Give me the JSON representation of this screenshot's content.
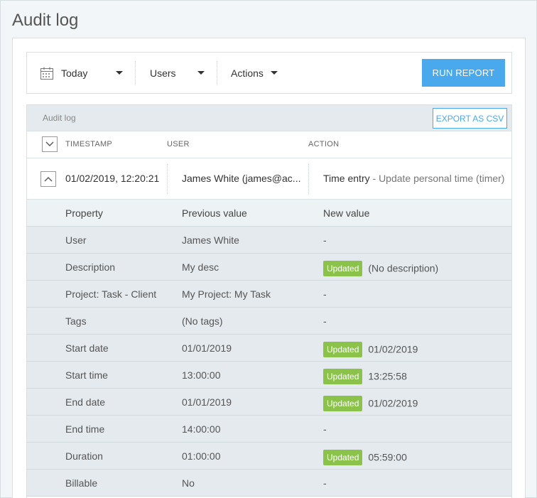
{
  "page": {
    "title": "Audit log"
  },
  "filters": {
    "date": "Today",
    "users": "Users",
    "actions": "Actions",
    "run_label": "RUN REPORT"
  },
  "log": {
    "label": "Audit log",
    "export_label": "EXPORT AS CSV",
    "columns": {
      "timestamp": "TIMESTAMP",
      "user": "USER",
      "action": "ACTION"
    },
    "entry": {
      "timestamp": "01/02/2019, 12:20:21",
      "user": "James White (james@ac...",
      "action_type": "Time entry",
      "action_sep": " - ",
      "action_detail": "Update personal time (timer)"
    },
    "details": {
      "headers": {
        "property": "Property",
        "previous": "Previous value",
        "new": "New value"
      },
      "rows": [
        {
          "property": "User",
          "previous": "James White",
          "badge": "",
          "new": "-"
        },
        {
          "property": "Description",
          "previous": "My desc",
          "badge": "Updated",
          "new": "(No description)"
        },
        {
          "property": "Project: Task - Client",
          "previous": "My Project: My Task",
          "badge": "",
          "new": "-"
        },
        {
          "property": "Tags",
          "previous": "(No tags)",
          "badge": "",
          "new": "-"
        },
        {
          "property": "Start date",
          "previous": "01/01/2019",
          "badge": "Updated",
          "new": "01/02/2019"
        },
        {
          "property": "Start time",
          "previous": "13:00:00",
          "badge": "Updated",
          "new": "13:25:58"
        },
        {
          "property": "End date",
          "previous": "01/01/2019",
          "badge": "Updated",
          "new": "01/02/2019"
        },
        {
          "property": "End time",
          "previous": "14:00:00",
          "badge": "",
          "new": "-"
        },
        {
          "property": "Duration",
          "previous": "01:00:00",
          "badge": "Updated",
          "new": "05:59:00"
        },
        {
          "property": "Billable",
          "previous": "No",
          "badge": "",
          "new": "-"
        }
      ]
    }
  },
  "colors": {
    "accent": "#4aa8ec",
    "badge": "#8bc34a",
    "row_bg": "#e4eaee"
  }
}
